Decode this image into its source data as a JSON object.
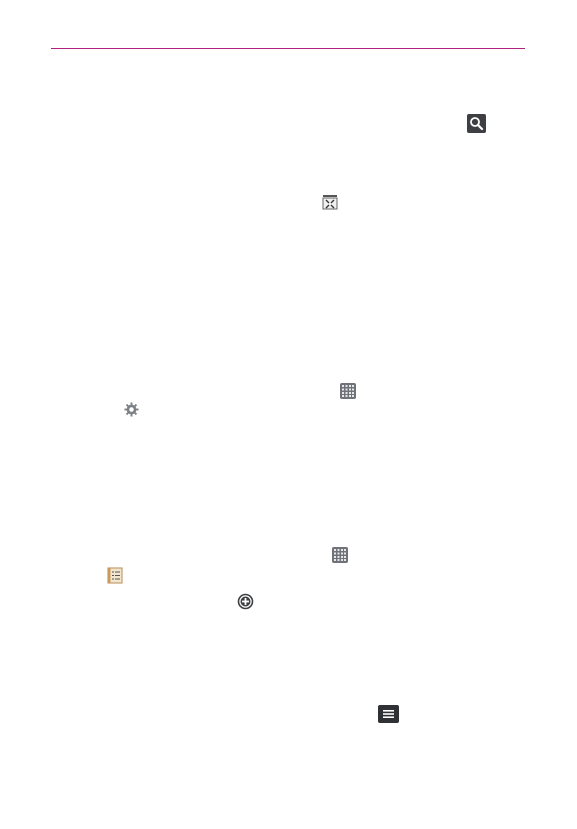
{
  "page": {
    "background": "#ffffff"
  },
  "header": {
    "rule_color": "#b0227e"
  },
  "icons": [
    {
      "name": "search-icon",
      "style": "dark-square"
    },
    {
      "name": "collapse-icon",
      "style": "outline"
    },
    {
      "name": "apps-grid-icon",
      "style": "grid"
    },
    {
      "name": "settings-gear-icon",
      "style": "gear"
    },
    {
      "name": "apps-grid-icon",
      "style": "grid"
    },
    {
      "name": "contacts-list-icon",
      "style": "notepad"
    },
    {
      "name": "add-circle-icon",
      "style": "plus-circle"
    },
    {
      "name": "menu-icon",
      "style": "dark-square"
    }
  ]
}
